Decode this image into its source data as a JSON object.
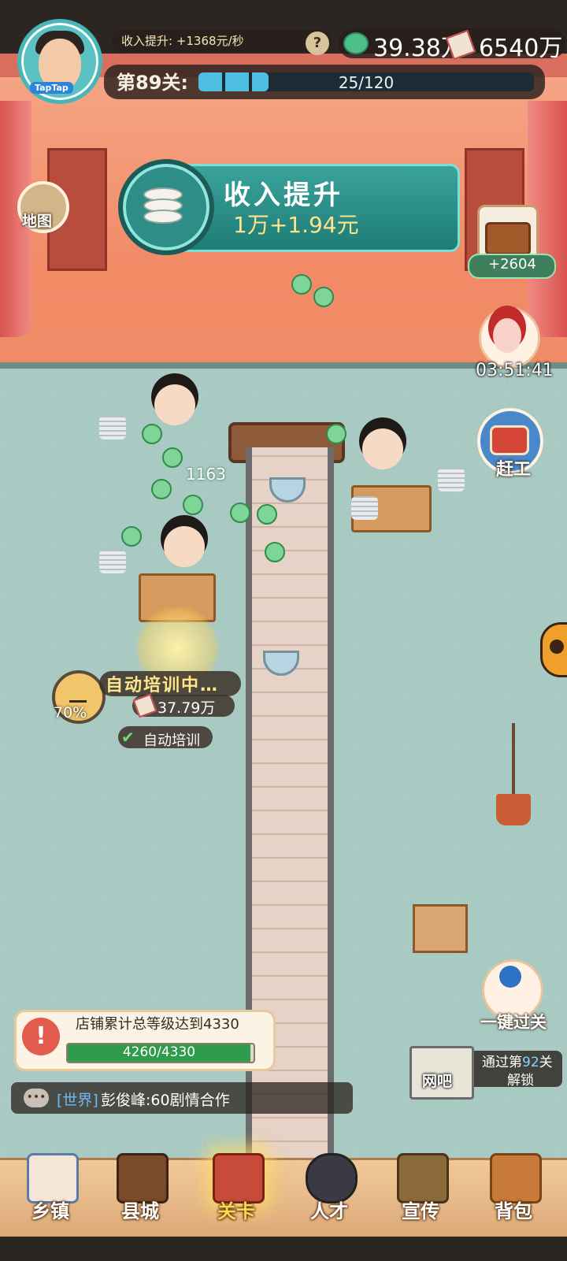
{
  "header": {
    "income_boost": "收入提升: +1368元/秒",
    "help": "?",
    "cash": "39.38万",
    "tickets": "6540万",
    "level_label": "第89关:",
    "level_progress": "25/120",
    "level_progress_fraction": 0.208,
    "avatar_badge": "TapTap"
  },
  "left_buttons": {
    "map": "地图"
  },
  "banner": {
    "title": "收入提升",
    "subtitle": "1万+1.94元"
  },
  "right_buttons": {
    "chest_bonus": "+2604",
    "event_timer": "03:51:41",
    "rush": "赶工",
    "skip": "一键过关"
  },
  "floor": {
    "cash_popup": "1163"
  },
  "training": {
    "title": "自动培训中…",
    "percent": "70%",
    "cost": "37.79万",
    "auto_label": "自动培训",
    "auto_checked": true
  },
  "unlock": {
    "line1_prefix": "通过第",
    "line1_level": "92",
    "line1_suffix": "关",
    "line2": "解锁",
    "building": "网吧"
  },
  "task": {
    "icon": "!",
    "text": "店铺累计总等级达到4330",
    "progress": "4260/4330",
    "fraction": 0.984
  },
  "chat": {
    "channel": "[世界]",
    "message": "彭俊峰:60剧情合作"
  },
  "nav": [
    {
      "label": "乡镇",
      "icon": "house-icon"
    },
    {
      "label": "县城",
      "icon": "tv-icon"
    },
    {
      "label": "关卡",
      "icon": "sewing-machine-icon",
      "active": true
    },
    {
      "label": "人才",
      "icon": "person-icon"
    },
    {
      "label": "宣传",
      "icon": "camera-icon"
    },
    {
      "label": "背包",
      "icon": "bag-icon"
    }
  ],
  "colors": {
    "accent_teal": "#1e7c76",
    "gold": "#ffd84a",
    "task_green": "#2f9b4c"
  }
}
